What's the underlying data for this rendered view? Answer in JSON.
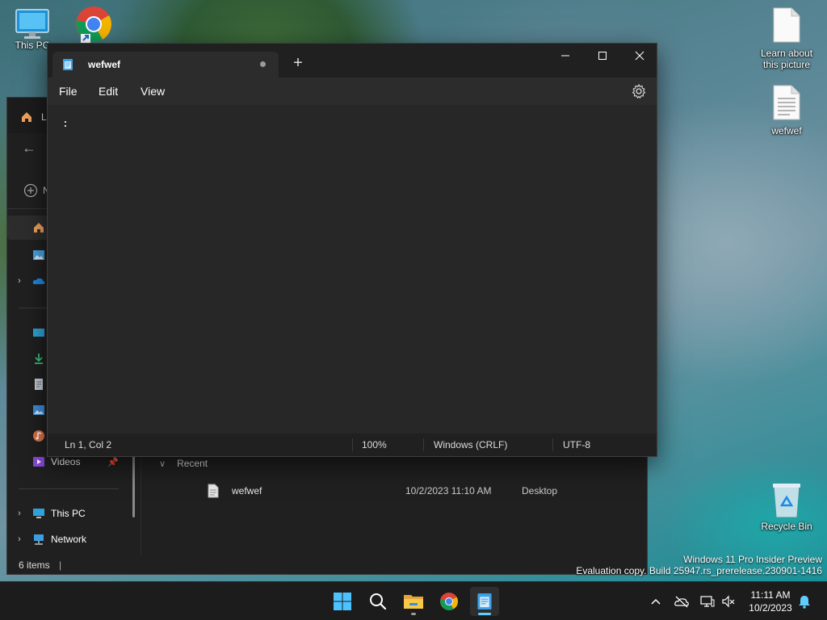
{
  "desktop": {
    "icons": [
      {
        "label": "This PC"
      },
      {
        "label": "Learn about this picture"
      },
      {
        "label": "wefwef"
      },
      {
        "label": "Recycle Bin"
      }
    ]
  },
  "explorer": {
    "title_partial": "L",
    "nav_partial": "N",
    "sidebar": {
      "videos_label": "Videos",
      "this_pc_label": "This PC",
      "network_label": "Network"
    },
    "recent_label": "Recent",
    "recent_row": {
      "name": "wefwef",
      "date": "10/2/2023 11:10 AM",
      "location": "Desktop"
    },
    "status_items": "6 items"
  },
  "notepad": {
    "tab_title": "wefwef",
    "menu": {
      "file": "File",
      "edit": "Edit",
      "view": "View"
    },
    "editor_content": ":",
    "status": {
      "position": "Ln 1, Col 2",
      "zoom": "100%",
      "line_ending": "Windows (CRLF)",
      "encoding": "UTF-8"
    }
  },
  "watermark": {
    "line1": "Windows 11 Pro Insider Preview",
    "line2": "Evaluation copy. Build 25947.rs_prerelease.230901-1416"
  },
  "taskbar": {
    "clock_time": "11:11 AM",
    "clock_date": "10/2/2023",
    "accent": "#60cdff"
  }
}
